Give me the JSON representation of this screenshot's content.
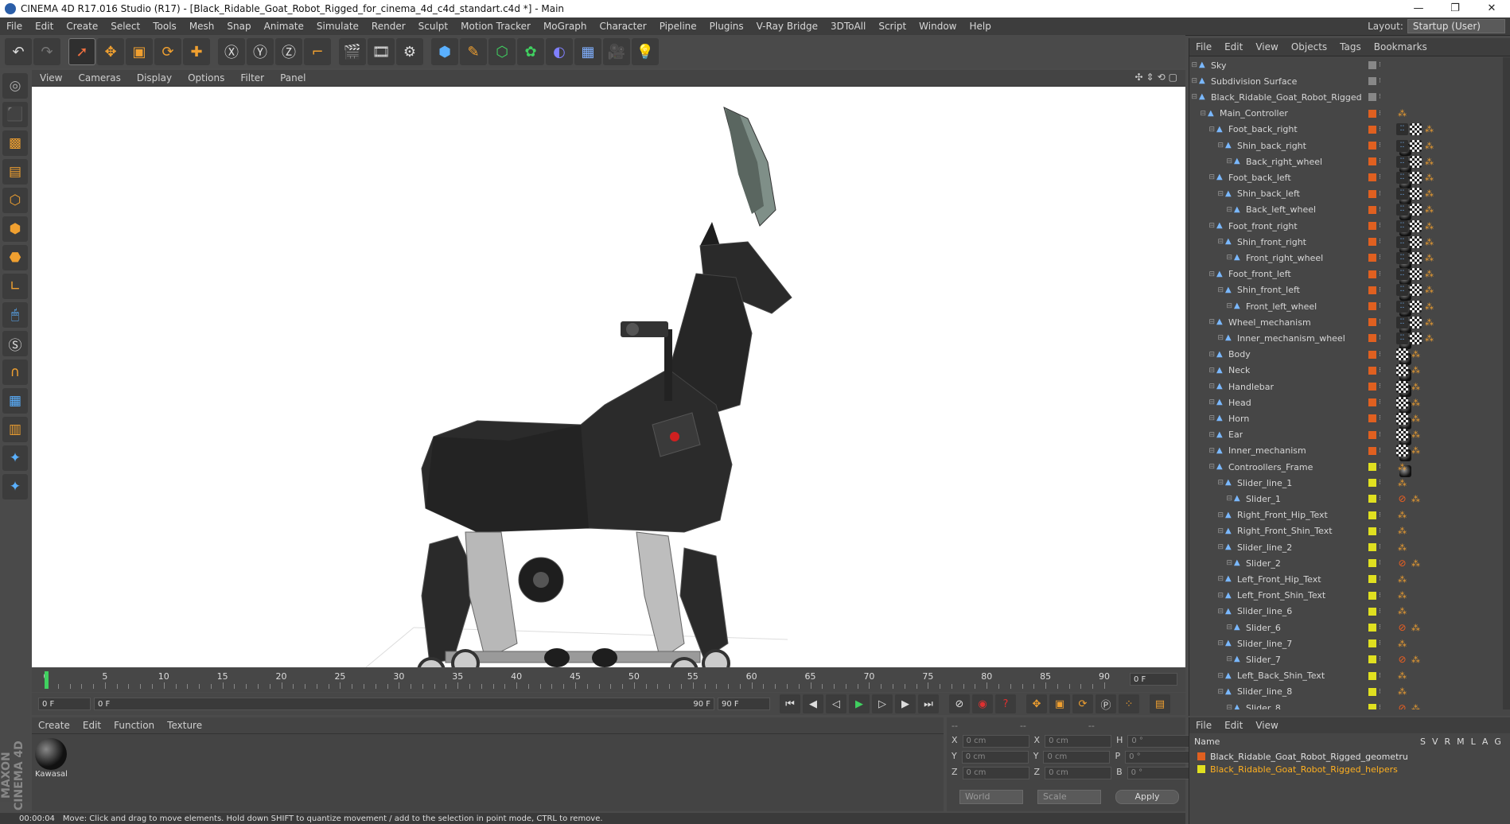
{
  "window": {
    "title": "CINEMA 4D R17.016 Studio (R17) - [Black_Ridable_Goat_Robot_Rigged_for_cinema_4d_c4d_standart.c4d *] - Main",
    "minimize": "—",
    "maximize": "❐",
    "close": "✕"
  },
  "menubar": {
    "items": [
      "File",
      "Edit",
      "Create",
      "Select",
      "Tools",
      "Mesh",
      "Snap",
      "Animate",
      "Simulate",
      "Render",
      "Sculpt",
      "Motion Tracker",
      "MoGraph",
      "Character",
      "Pipeline",
      "Plugins",
      "V-Ray Bridge",
      "3DToAll",
      "Script",
      "Window",
      "Help"
    ],
    "layout_label": "Layout:",
    "layout_value": "Startup (User)"
  },
  "viewport": {
    "menu": [
      "View",
      "Cameras",
      "Display",
      "Options",
      "Filter",
      "Panel"
    ],
    "nav_icons": "✣⇕⟲▢"
  },
  "timeline": {
    "ticks": [
      0,
      5,
      10,
      15,
      20,
      25,
      30,
      35,
      40,
      45,
      50,
      55,
      60,
      65,
      70,
      75,
      80,
      85,
      90
    ],
    "current_frame": "0 F"
  },
  "transport": {
    "start_field": "0 F",
    "range_start": "0 F",
    "range_end": "90 F",
    "end_field": "90 F"
  },
  "material_panel": {
    "menu": [
      "Create",
      "Edit",
      "Function",
      "Texture"
    ],
    "materials": [
      {
        "name": "Kawasal"
      }
    ]
  },
  "branding": {
    "maxon": "MAXON CINEMA 4D"
  },
  "coords": {
    "headers": [
      "--",
      "--",
      "--"
    ],
    "rows": [
      {
        "a": "X",
        "av": "0 cm",
        "b": "X",
        "bv": "0 cm",
        "c": "H",
        "cv": "0 °"
      },
      {
        "a": "Y",
        "av": "0 cm",
        "b": "Y",
        "bv": "0 cm",
        "c": "P",
        "cv": "0 °"
      },
      {
        "a": "Z",
        "av": "0 cm",
        "b": "Z",
        "bv": "0 cm",
        "c": "B",
        "cv": "0 °"
      }
    ],
    "world": "World",
    "scale": "Scale",
    "apply": "Apply"
  },
  "status": {
    "time": "00:00:04",
    "message": "Move: Click and drag to move elements. Hold down SHIFT to quantize movement / add to the selection in point mode, CTRL to remove."
  },
  "object_manager": {
    "menu": [
      "File",
      "Edit",
      "View",
      "Objects",
      "Tags",
      "Bookmarks"
    ],
    "objects": [
      {
        "name": "Sky",
        "depth": 0,
        "color": "#888888",
        "tags": ""
      },
      {
        "name": "Subdivision Surface",
        "depth": 0,
        "color": "#888888",
        "tags": ""
      },
      {
        "name": "Black_Ridable_Goat_Robot_Rigged",
        "depth": 0,
        "color": "#888888",
        "tags": ""
      },
      {
        "name": "Main_Controller",
        "depth": 1,
        "color": "#e06020",
        "tags": "i"
      },
      {
        "name": "Foot_back_right",
        "depth": 2,
        "color": "#e06020",
        "tags": "bmci"
      },
      {
        "name": "Shin_back_right",
        "depth": 3,
        "color": "#e06020",
        "tags": "bmci"
      },
      {
        "name": "Back_right_wheel",
        "depth": 4,
        "color": "#e06020",
        "tags": "bmci"
      },
      {
        "name": "Foot_back_left",
        "depth": 2,
        "color": "#e06020",
        "tags": "bmci"
      },
      {
        "name": "Shin_back_left",
        "depth": 3,
        "color": "#e06020",
        "tags": "bmci"
      },
      {
        "name": "Back_left_wheel",
        "depth": 4,
        "color": "#e06020",
        "tags": "bmci"
      },
      {
        "name": "Foot_front_right",
        "depth": 2,
        "color": "#e06020",
        "tags": "bmci"
      },
      {
        "name": "Shin_front_right",
        "depth": 3,
        "color": "#e06020",
        "tags": "bmci"
      },
      {
        "name": "Front_right_wheel",
        "depth": 4,
        "color": "#e06020",
        "tags": "bmci"
      },
      {
        "name": "Foot_front_left",
        "depth": 2,
        "color": "#e06020",
        "tags": "bmci"
      },
      {
        "name": "Shin_front_left",
        "depth": 3,
        "color": "#e06020",
        "tags": "bmci"
      },
      {
        "name": "Front_left_wheel",
        "depth": 4,
        "color": "#e06020",
        "tags": "bmci"
      },
      {
        "name": "Wheel_mechanism",
        "depth": 2,
        "color": "#e06020",
        "tags": "bmci"
      },
      {
        "name": "Inner_mechanism_wheel",
        "depth": 3,
        "color": "#e06020",
        "tags": "bmci"
      },
      {
        "name": "Body",
        "depth": 2,
        "color": "#e06020",
        "tags": "mci"
      },
      {
        "name": "Neck",
        "depth": 2,
        "color": "#e06020",
        "tags": "mci"
      },
      {
        "name": "Handlebar",
        "depth": 2,
        "color": "#e06020",
        "tags": "mci"
      },
      {
        "name": "Head",
        "depth": 2,
        "color": "#e06020",
        "tags": "mci"
      },
      {
        "name": "Horn",
        "depth": 2,
        "color": "#e06020",
        "tags": "mci"
      },
      {
        "name": "Ear",
        "depth": 2,
        "color": "#e06020",
        "tags": "mci"
      },
      {
        "name": "Inner_mechanism",
        "depth": 2,
        "color": "#e06020",
        "tags": "mci"
      },
      {
        "name": "Controollers_Frame",
        "depth": 2,
        "color": "#e0e020",
        "tags": "i"
      },
      {
        "name": "Slider_line_1",
        "depth": 3,
        "color": "#e0e020",
        "tags": "i"
      },
      {
        "name": "Slider_1",
        "depth": 4,
        "color": "#e0e020",
        "tags": "ni"
      },
      {
        "name": "Right_Front_Hip_Text",
        "depth": 3,
        "color": "#e0e020",
        "tags": "i"
      },
      {
        "name": "Right_Front_Shin_Text",
        "depth": 3,
        "color": "#e0e020",
        "tags": "i"
      },
      {
        "name": "Slider_line_2",
        "depth": 3,
        "color": "#e0e020",
        "tags": "i"
      },
      {
        "name": "Slider_2",
        "depth": 4,
        "color": "#e0e020",
        "tags": "ni"
      },
      {
        "name": "Left_Front_Hip_Text",
        "depth": 3,
        "color": "#e0e020",
        "tags": "i"
      },
      {
        "name": "Left_Front_Shin_Text",
        "depth": 3,
        "color": "#e0e020",
        "tags": "i"
      },
      {
        "name": "Slider_line_6",
        "depth": 3,
        "color": "#e0e020",
        "tags": "i"
      },
      {
        "name": "Slider_6",
        "depth": 4,
        "color": "#e0e020",
        "tags": "ni"
      },
      {
        "name": "Slider_line_7",
        "depth": 3,
        "color": "#e0e020",
        "tags": "i"
      },
      {
        "name": "Slider_7",
        "depth": 4,
        "color": "#e0e020",
        "tags": "ni"
      },
      {
        "name": "Left_Back_Shin_Text",
        "depth": 3,
        "color": "#e0e020",
        "tags": "i"
      },
      {
        "name": "Slider_line_8",
        "depth": 3,
        "color": "#e0e020",
        "tags": "i"
      },
      {
        "name": "Slider_8",
        "depth": 4,
        "color": "#e0e020",
        "tags": "ni"
      }
    ]
  },
  "layer_manager": {
    "menu": [
      "File",
      "Edit",
      "View"
    ],
    "header_name": "Name",
    "header_cols": [
      "S",
      "V",
      "R",
      "M",
      "L",
      "A",
      "G"
    ],
    "layers": [
      {
        "name": "Black_Ridable_Goat_Robot_Rigged_geometru",
        "color": "#e06020",
        "text_color": "#e0e0e0"
      },
      {
        "name": "Black_Ridable_Goat_Robot_Rigged_helpers",
        "color": "#e0e020",
        "text_color": "#ffb020"
      }
    ]
  }
}
